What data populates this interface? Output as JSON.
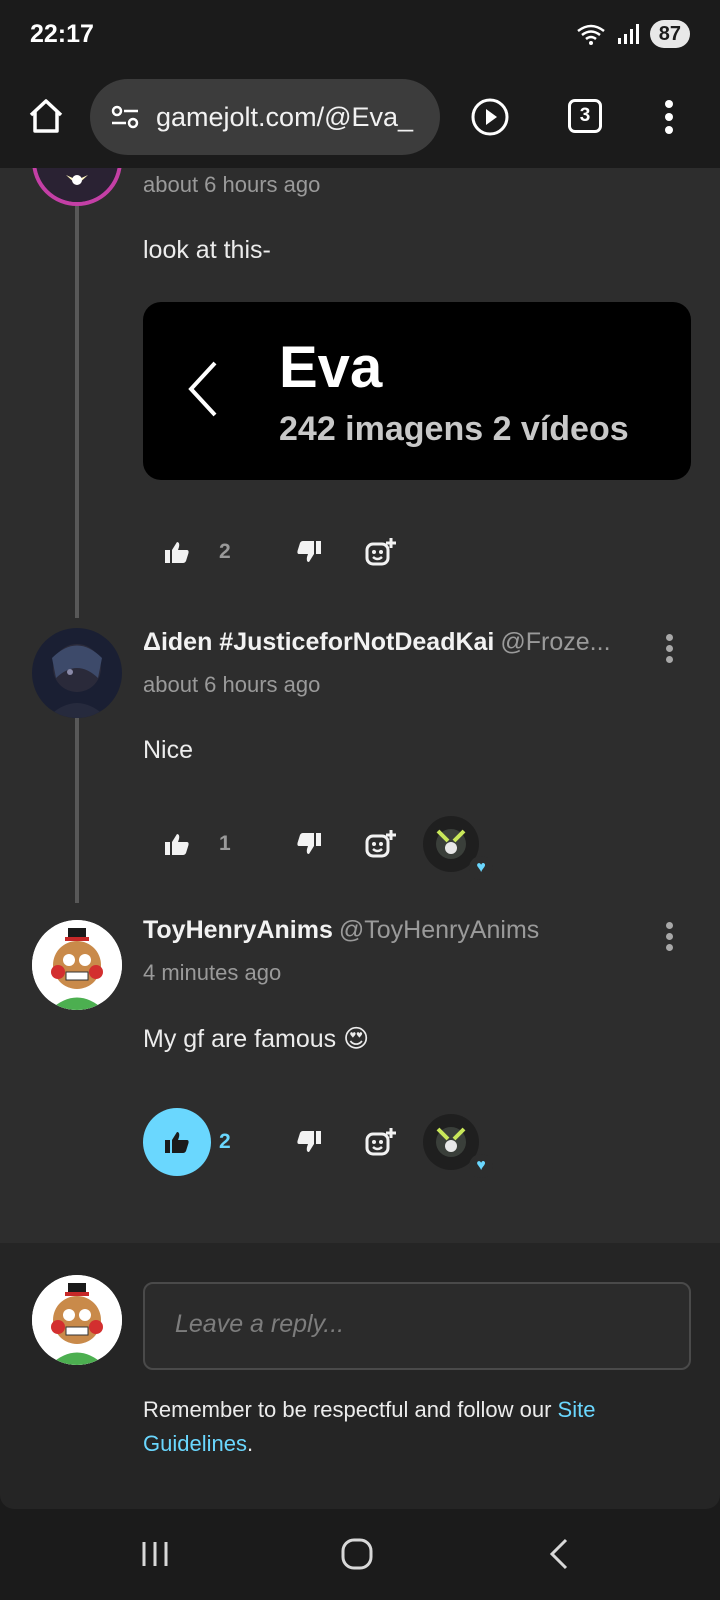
{
  "status_bar": {
    "time": "22:17",
    "battery": "87"
  },
  "browser": {
    "url": "gamejolt.com/@Eva_",
    "tabs_count": "3"
  },
  "comments": [
    {
      "time": "about 6 hours ago",
      "body": "look at this-",
      "embed": {
        "title": "Eva",
        "subtitle": "242 imagens 2 vídeos"
      },
      "likes": "2"
    },
    {
      "name": "Δiden #JusticeforNotDeadKai",
      "handle": "@Froze...",
      "time": "about 6 hours ago",
      "body": "Nice",
      "likes": "1"
    },
    {
      "name": "ToyHenryAnims",
      "handle": "@ToyHenryAnims",
      "time": "4 minutes ago",
      "body": "My gf are famous 😍",
      "likes": "2"
    }
  ],
  "reply": {
    "placeholder": "Leave a reply...",
    "guidelines_prefix": "Remember to be respectful and follow our ",
    "guidelines_link": "Site Guidelines",
    "guidelines_suffix": "."
  },
  "colors": {
    "accent": "#6ad7fe",
    "background": "#2d2d2d"
  }
}
